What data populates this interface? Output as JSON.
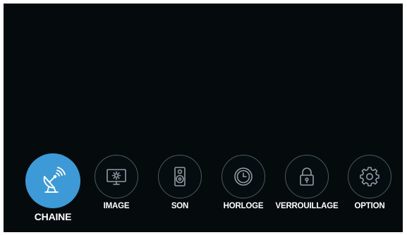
{
  "menu": {
    "items": [
      {
        "label": "CHAINE",
        "icon": "satellite-dish-icon",
        "selected": true
      },
      {
        "label": "IMAGE",
        "icon": "monitor-brightness-icon",
        "selected": false
      },
      {
        "label": "SON",
        "icon": "speaker-icon",
        "selected": false
      },
      {
        "label": "HORLOGE",
        "icon": "clock-icon",
        "selected": false
      },
      {
        "label": "VERROUILLAGE",
        "icon": "lock-icon",
        "selected": false
      },
      {
        "label": "OPTION",
        "icon": "gear-icon",
        "selected": false
      }
    ]
  },
  "colors": {
    "background": "#050b0d",
    "accent": "#3d9ad6",
    "ring": "#4a5a63",
    "icon": "#8f9ca3",
    "text": "#ffffff"
  }
}
